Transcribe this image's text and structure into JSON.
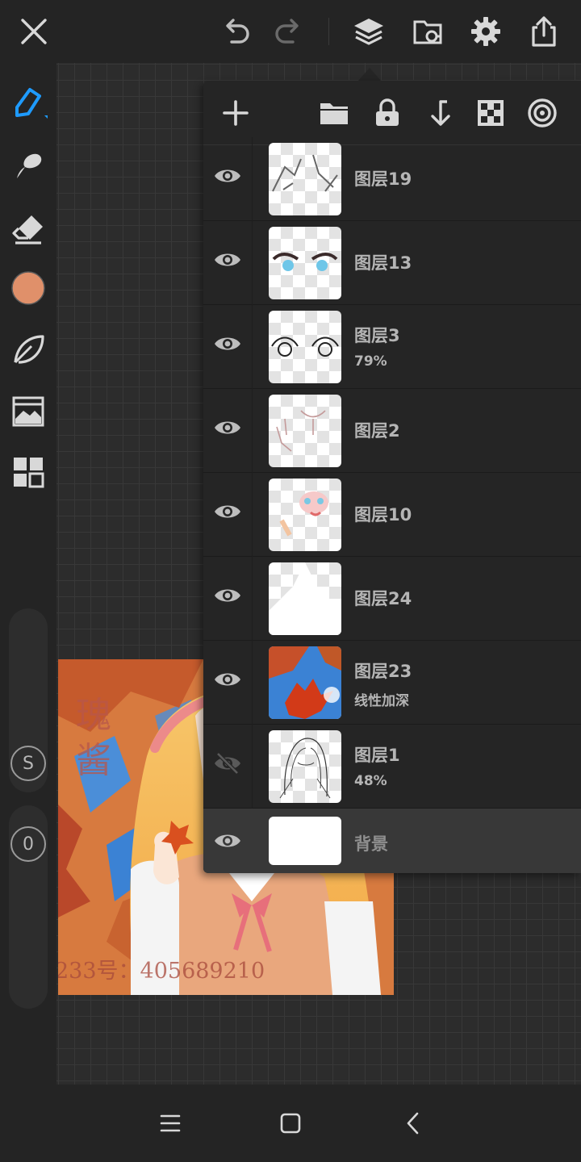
{
  "colors": {
    "accent": "#1e9bff",
    "brush_color": "#e0906a",
    "icon": "#d8d8d8",
    "panel_bg": "#252525"
  },
  "left_slider": {
    "size_label": "S",
    "opacity_label": "0"
  },
  "artwork": {
    "watermark_chars": "瑰\n酱",
    "watermark_id": "233号：405689210"
  },
  "layers": [
    {
      "name": "图层19",
      "sub": "",
      "visible": true
    },
    {
      "name": "图层13",
      "sub": "",
      "visible": true
    },
    {
      "name": "图层3",
      "sub": "79%",
      "visible": true
    },
    {
      "name": "图层2",
      "sub": "",
      "visible": true
    },
    {
      "name": "图层10",
      "sub": "",
      "visible": true
    },
    {
      "name": "图层24",
      "sub": "",
      "visible": true
    },
    {
      "name": "图层23",
      "sub": "线性加深",
      "visible": true
    },
    {
      "name": "图层1",
      "sub": "48%",
      "visible": false
    },
    {
      "name": "背景",
      "sub": "",
      "visible": true,
      "selected": true
    }
  ],
  "icons": {
    "top": [
      "close-icon",
      "undo-icon",
      "redo-icon",
      "layers-icon",
      "gallery-icon",
      "settings-icon",
      "share-icon"
    ],
    "left": [
      "pen-icon",
      "smudge-icon",
      "eraser-icon",
      "color-swatch",
      "leaf-icon",
      "reference-image-icon",
      "grid-apps-icon"
    ],
    "panel": [
      "add-layer-icon",
      "folder-icon",
      "lock-icon",
      "merge-down-icon",
      "checkerboard-icon",
      "target-icon"
    ],
    "nav": [
      "menu-icon",
      "home-icon",
      "back-icon"
    ]
  }
}
